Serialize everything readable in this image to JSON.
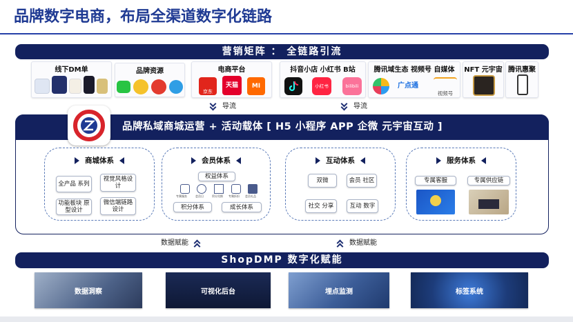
{
  "title": "品牌数字电商，布局全渠道数字化链路",
  "top_band": "营销矩阵 ： 全链路引流",
  "channels": [
    {
      "label": "线下DM单",
      "icon": "print-material-icon"
    },
    {
      "label": "品牌资源",
      "icon": "brand-apps-icon"
    },
    {
      "label": "电商平台",
      "icon": "ecommerce-apps-icon"
    },
    {
      "label": "抖音小店 小红书 B站",
      "icon": "social-apps-icon"
    },
    {
      "label": "腾讯域生态  视频号 自媒体",
      "icon": "tencent-apps-icon"
    },
    {
      "label": "NFT 元宇宙",
      "icon": "nft-icon"
    },
    {
      "label": "腾讯惠聚",
      "icon": "phone-icon"
    }
  ],
  "app_texts": {
    "taobao": "天猫",
    "jd": "京东",
    "xiaohongshu": "小红书",
    "bilibili": "bilibili",
    "guangdiantong": "广点通",
    "shipinhao": "视频号",
    "mi": "MI"
  },
  "flow_top": [
    "导流",
    "导流"
  ],
  "mid_band": "品牌私域商城运营  + 活动载体 [ H5 小程序 APP 企微 元宇宙互动 ]",
  "cards": [
    {
      "title": "商城体系",
      "items": [
        "全产品 系列",
        "视觉风格设计",
        "功能板块 原型设计",
        "微信端链路设计"
      ]
    },
    {
      "title": "会员体系",
      "sub_header": "权益体系",
      "icons": [
        "专属服务",
        "会员日",
        "积分兑换",
        "专属折扣",
        "会员礼品"
      ],
      "items": [
        "积分体系",
        "成长体系"
      ]
    },
    {
      "title": "互动体系",
      "items": [
        "双微",
        "会员 社区",
        "社交 分享",
        "互动 数字"
      ]
    },
    {
      "title": "服务体系",
      "items": [
        "专属客服",
        "专属供应链"
      ]
    }
  ],
  "flow_bottom": [
    "数据赋能",
    "数据赋能"
  ],
  "bottom_band": "ShopDMP 数字化赋能",
  "dmp_items": [
    "数据洞察",
    "可视化后台",
    "埋点监测",
    "标签系统"
  ],
  "colors": {
    "navy": "#13215e",
    "title_blue": "#1f3a93",
    "dashed": "#5a7ab8"
  }
}
